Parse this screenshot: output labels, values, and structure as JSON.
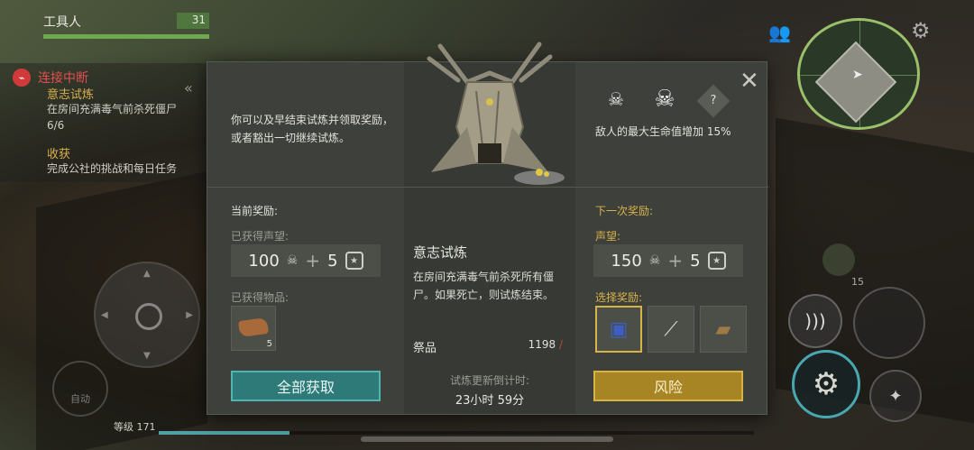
{
  "hud": {
    "worker_label": "工具人",
    "worker_value": "31",
    "disconnect": "连接中断",
    "quests": [
      {
        "title": "意志试炼",
        "desc": "在房间充满毒气前杀死僵尸",
        "progress": "6/6"
      },
      {
        "title": "收获",
        "desc": "完成公社的挑战和每日任务"
      }
    ],
    "level": "等级 171",
    "auto": "自动",
    "bag_count": "15"
  },
  "modal": {
    "intro": "你可以及早结束试炼并领取奖励，或者豁出一切继续试炼。",
    "current_reward_label": "当前奖励:",
    "earned_rep_label": "已获得声望:",
    "earned_rep_value": "100",
    "earned_rep_badge": "5",
    "earned_items_label": "已获得物品:",
    "earned_item_count": "5",
    "collect_all": "全部获取",
    "trial_title": "意志试炼",
    "trial_desc": "在房间充满毒气前杀死所有僵尸。如果死亡，则试炼结束。",
    "offering_label": "祭品",
    "offering_value": "1198",
    "timer_label": "试炼更新倒计时:",
    "timer_value": "23小时 59分",
    "enemy_note": "敌人的最大生命值增加 15%",
    "help_mark": "?",
    "next_reward_label": "下一次奖励:",
    "next_rep_label": "声望:",
    "next_rep_value": "150",
    "next_rep_badge": "5",
    "choose_reward_label": "选择奖励:",
    "risk": "风险"
  },
  "icons": {
    "close": "close-icon",
    "skull": "skull-icon",
    "skull_plus": "skull-plus-icon",
    "horns": "horned-skull-icon",
    "badge": "hex-badge-icon"
  },
  "colors": {
    "accent_gold": "#d9b24a",
    "accent_teal": "#4fb5b0",
    "alert_red": "#d03a3a"
  }
}
